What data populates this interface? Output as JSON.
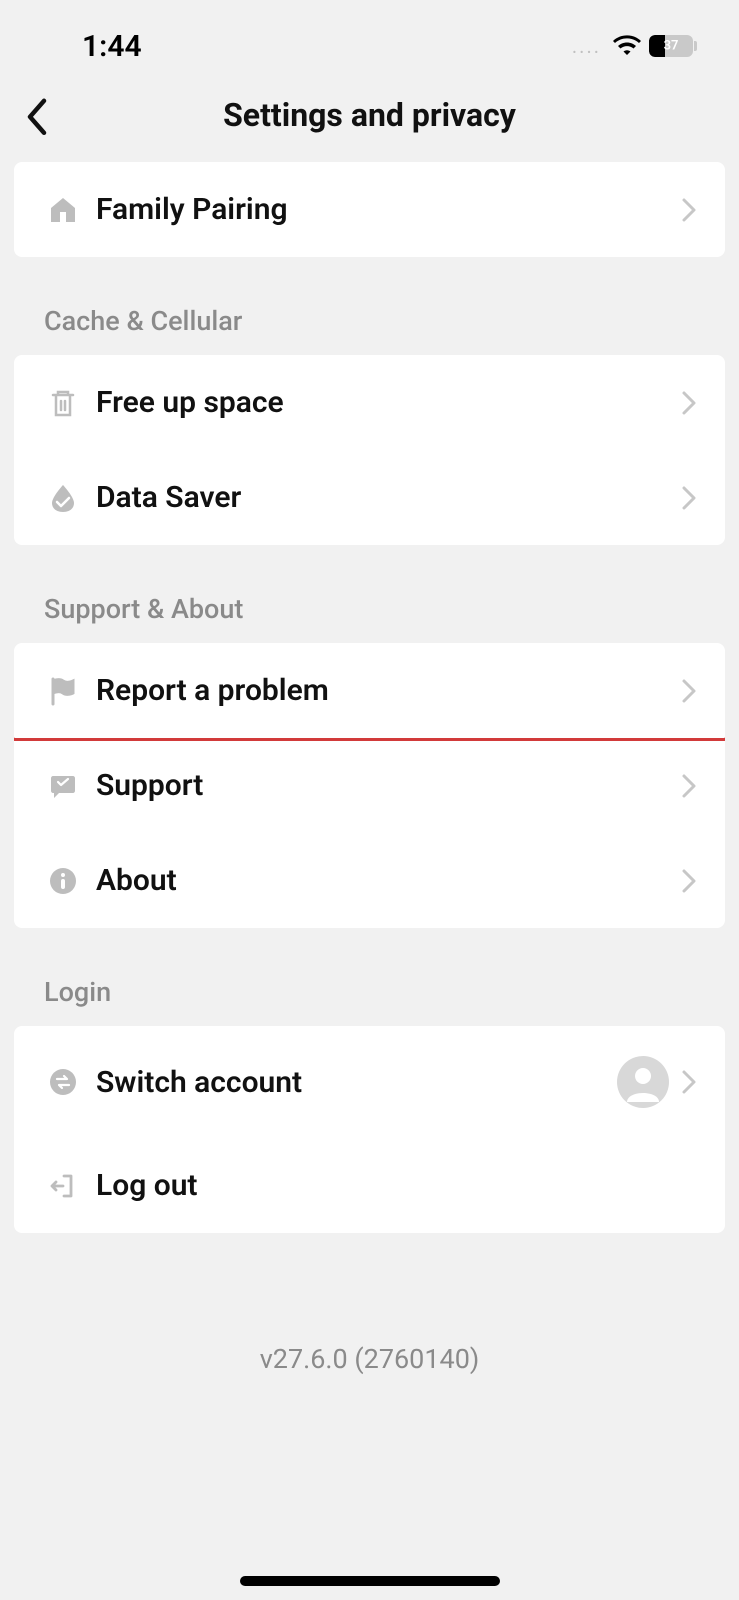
{
  "status": {
    "time": "1:44",
    "battery": "37"
  },
  "header": {
    "title": "Settings and privacy"
  },
  "sections": {
    "top": {
      "family_pairing": "Family Pairing"
    },
    "cache": {
      "title": "Cache & Cellular",
      "free_up_space": "Free up space",
      "data_saver": "Data Saver"
    },
    "support": {
      "title": "Support & About",
      "report": "Report a problem",
      "support": "Support",
      "about": "About"
    },
    "login": {
      "title": "Login",
      "switch": "Switch account",
      "logout": "Log out"
    }
  },
  "version": "v27.6.0 (2760140)"
}
